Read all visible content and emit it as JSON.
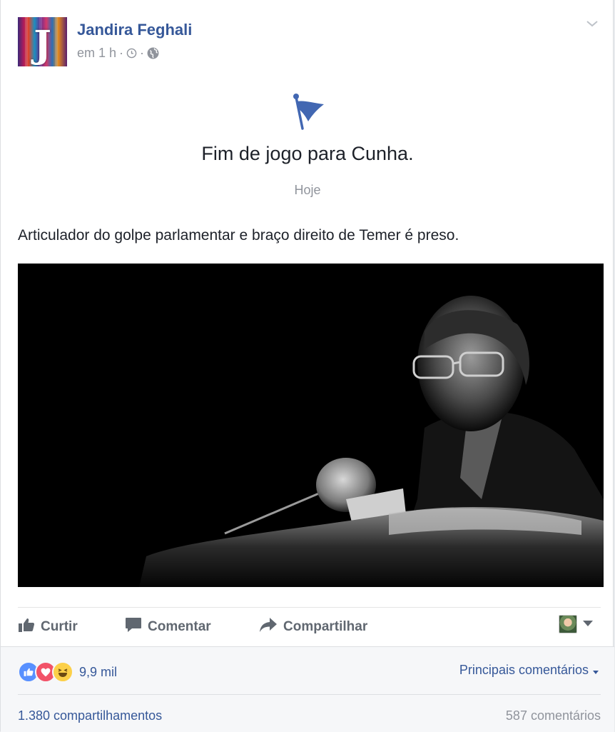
{
  "post": {
    "author": "Jandira Feghali",
    "avatar_letter": "J",
    "time": "em 1 h",
    "sep": "·",
    "icons": {
      "clock": "clock-icon",
      "privacy": "globe-icon",
      "menu": "chevron-down-icon"
    }
  },
  "event": {
    "icon": "flag-icon",
    "title": "Fim de jogo para Cunha.",
    "date": "Hoje"
  },
  "text": "Articulador do golpe parlamentar e braço direito de Temer é preso.",
  "actions": {
    "like": "Curtir",
    "comment": "Comentar",
    "share": "Compartilhar"
  },
  "footer": {
    "reaction_count": "9,9 mil",
    "top_comments": "Principais comentários",
    "shares": "1.380 compartilhamentos",
    "comments": "587 comentários"
  },
  "colors": {
    "link": "#365899",
    "muted": "#90949c",
    "action": "#606770",
    "like": "#5890ff",
    "love": "#f25268",
    "haha": "#fcd049"
  }
}
